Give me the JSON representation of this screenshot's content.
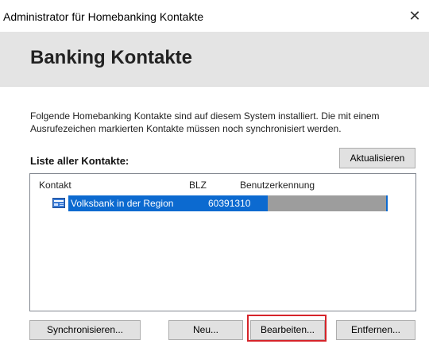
{
  "window": {
    "title": "Administrator für Homebanking Kontakte",
    "close_glyph": "✕"
  },
  "banner": {
    "heading": "Banking Kontakte"
  },
  "intro_text": "Folgende Homebanking Kontakte sind auf diesem System installiert. Die mit einem Ausrufezeichen markierten Kontakte müssen noch synchronisiert werden.",
  "list": {
    "label": "Liste aller Kontakte:",
    "refresh_label": "Aktualisieren",
    "columns": [
      "Kontakt",
      "BLZ",
      "Benutzerkennung"
    ],
    "rows": [
      {
        "icon": "bank-contact-icon",
        "kontakt": "Volksbank in der Region",
        "blz": "60391310",
        "benutzerkennung": "",
        "selected": true
      }
    ]
  },
  "buttons": {
    "sync": "Synchronisieren...",
    "new": "Neu...",
    "edit": "Bearbeiten...",
    "remove": "Entfernen..."
  },
  "colors": {
    "selection": "#0c6ad0",
    "redacted": "#9d9d9d",
    "highlight": "#d6242a",
    "banner": "#e4e4e4"
  }
}
